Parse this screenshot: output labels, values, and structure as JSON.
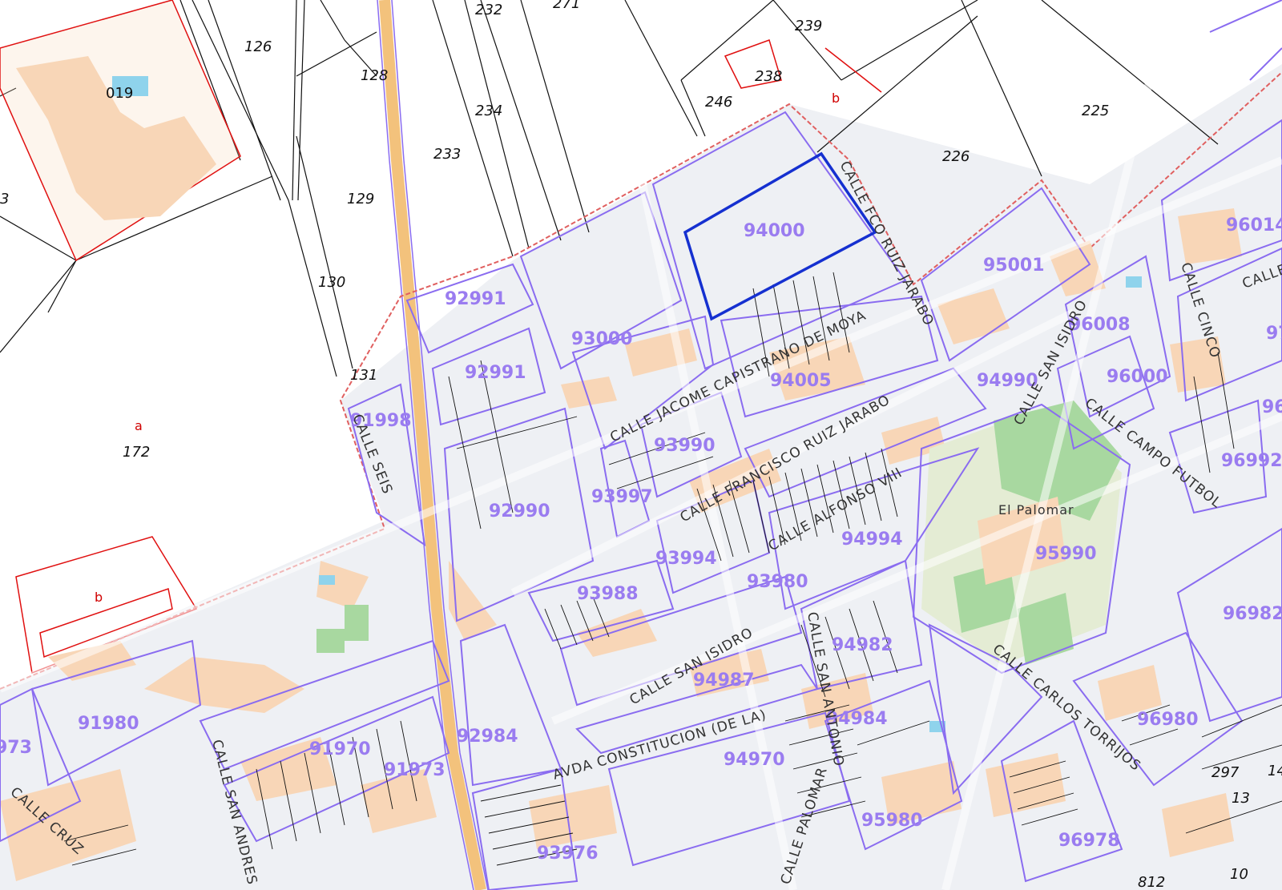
{
  "colors": {
    "background": "#ffffff",
    "urban_fill": "#eef0f4",
    "building": "#f8d6b7",
    "block_outline": "#8a6cf0",
    "block_label": "#9a7cf0",
    "rural_line": "#111111",
    "subparcel_red": "#e01010",
    "selected_parcel": "#1530d0",
    "road": "#f3c27c",
    "sports_field": "#a8d8a0",
    "pool": "#8fd3ec"
  },
  "map": {
    "rural_parcels": [
      "126",
      "019",
      "128",
      "232",
      "271",
      "239",
      "238",
      "246",
      "234",
      "233",
      "129",
      "130",
      "131",
      "172",
      "226",
      "225"
    ],
    "subparcel_labels": [
      "b",
      "a",
      "b"
    ],
    "urban_blocks": [
      "92991",
      "93000",
      "94000",
      "95001",
      "96014",
      "96008",
      "92991",
      "94005",
      "94990",
      "96000",
      "91998",
      "93990",
      "92990",
      "93997",
      "96992",
      "93994",
      "94994",
      "95990",
      "93988",
      "93980",
      "96982",
      "94982",
      "94987",
      "91980",
      "94984",
      "96980",
      "92984",
      "91970",
      "91973",
      "94970",
      "95980",
      "96978",
      "93976"
    ],
    "cut_labels": [
      "97",
      "96",
      "3",
      "973"
    ],
    "streets": [
      "CALLE FCO RUIZ JARABO",
      "CALLE JACOME CAPISTRANO DE MOYA",
      "CALLE SAN ISIDRO",
      "CALLE CINCO",
      "CALLE CAMPO FUTBOL",
      "CALLE SEIS",
      "CALLE FRANCISCO RUIZ JARABO",
      "CALLE ALFONSO VIII",
      "CALLE SAN ISIDRO",
      "CALLE CARLOS TORRIJOS",
      "CALLE SAN ANTONIO",
      "AVDA CONSTITUCION (DE LA)",
      "CALLE SAN ANDRES",
      "CALLE CRUZ",
      "CALLE PALOMAR",
      "CALLE"
    ],
    "place": "El Palomar",
    "corner_parcels": [
      "297",
      "13",
      "10",
      "812",
      "14"
    ],
    "selected_block": "94000"
  }
}
